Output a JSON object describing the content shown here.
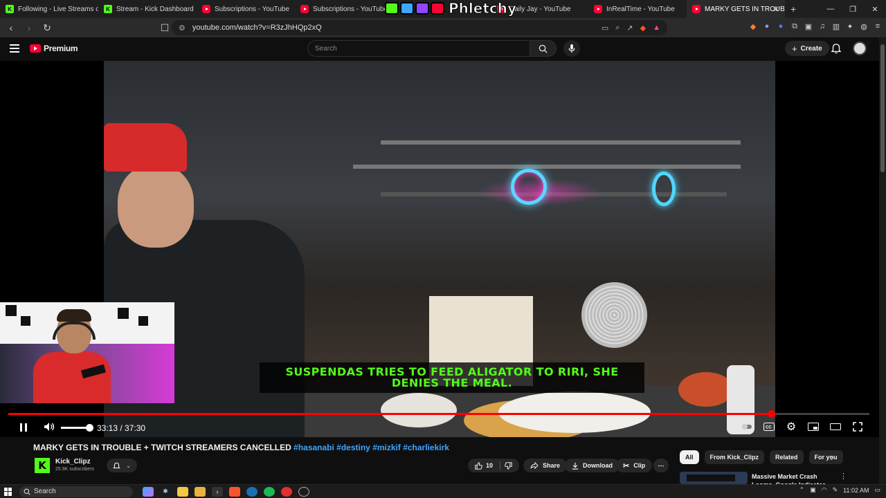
{
  "browser": {
    "tabs": [
      {
        "title": "Following - Live Streams on Ki",
        "favicon": "kick"
      },
      {
        "title": "Stream - Kick Dashboard",
        "favicon": "kick"
      },
      {
        "title": "Subscriptions - YouTube",
        "favicon": "youtube"
      },
      {
        "title": "Subscriptions - YouTube",
        "favicon": "youtube"
      },
      {
        "title": "Daily Jay - YouTube",
        "favicon": "youtube"
      },
      {
        "title": "InRealTime - YouTube",
        "favicon": "youtube"
      },
      {
        "title": "MARKY GETS IN TROUB",
        "favicon": "youtube",
        "active": true
      }
    ],
    "overlay_logo_text": "Phletchy",
    "url": "youtube.com/watch?v=R3zJhHQp2xQ"
  },
  "youtube": {
    "logo_text": "Premium",
    "search_placeholder": "Search",
    "create_label": "Create"
  },
  "player": {
    "caption": "SUSPENDAS TRIES TO FEED ALIGATOR TO RIRI, SHE DENIES THE MEAL.",
    "time": "33:13 / 37:30",
    "progress_fraction": 0.886,
    "volume_fraction": 1.0
  },
  "video": {
    "title": "MARKY GETS IN TROUBLE + TWITCH STREAMERS CANCELLED",
    "hashtags": "#hasanabi #destiny #mizkif #charliekirk",
    "channel_name": "Kick_Clipz",
    "channel_logo_letter": "K",
    "subscribers": "25.9K subscribers",
    "likes": "10",
    "share_label": "Share",
    "download_label": "Download",
    "clip_label": "Clip"
  },
  "sidebar": {
    "chips": [
      "All",
      "From Kick_Clipz",
      "Related",
      "For you"
    ],
    "rec_title": "Massive Market Crash Looms, Google Indicates Housing"
  },
  "taskbar": {
    "search_label": "Search",
    "time": "11:02 AM"
  },
  "colors": {
    "youtube_red": "#ff0033",
    "kick_green": "#53fc18",
    "hashtag_blue": "#3ea6ff"
  }
}
